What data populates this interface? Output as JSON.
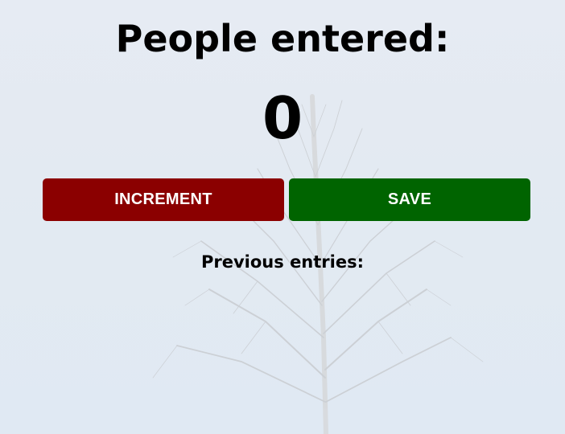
{
  "header": {
    "title": "People entered:"
  },
  "counter": {
    "value": "0"
  },
  "buttons": {
    "increment_label": "INCREMENT",
    "save_label": "SAVE"
  },
  "entries": {
    "heading": "Previous entries:",
    "items": []
  },
  "colors": {
    "increment_bg": "#8b0000",
    "save_bg": "#006400",
    "button_text": "#ffffff",
    "background": "#e3eaf2"
  }
}
